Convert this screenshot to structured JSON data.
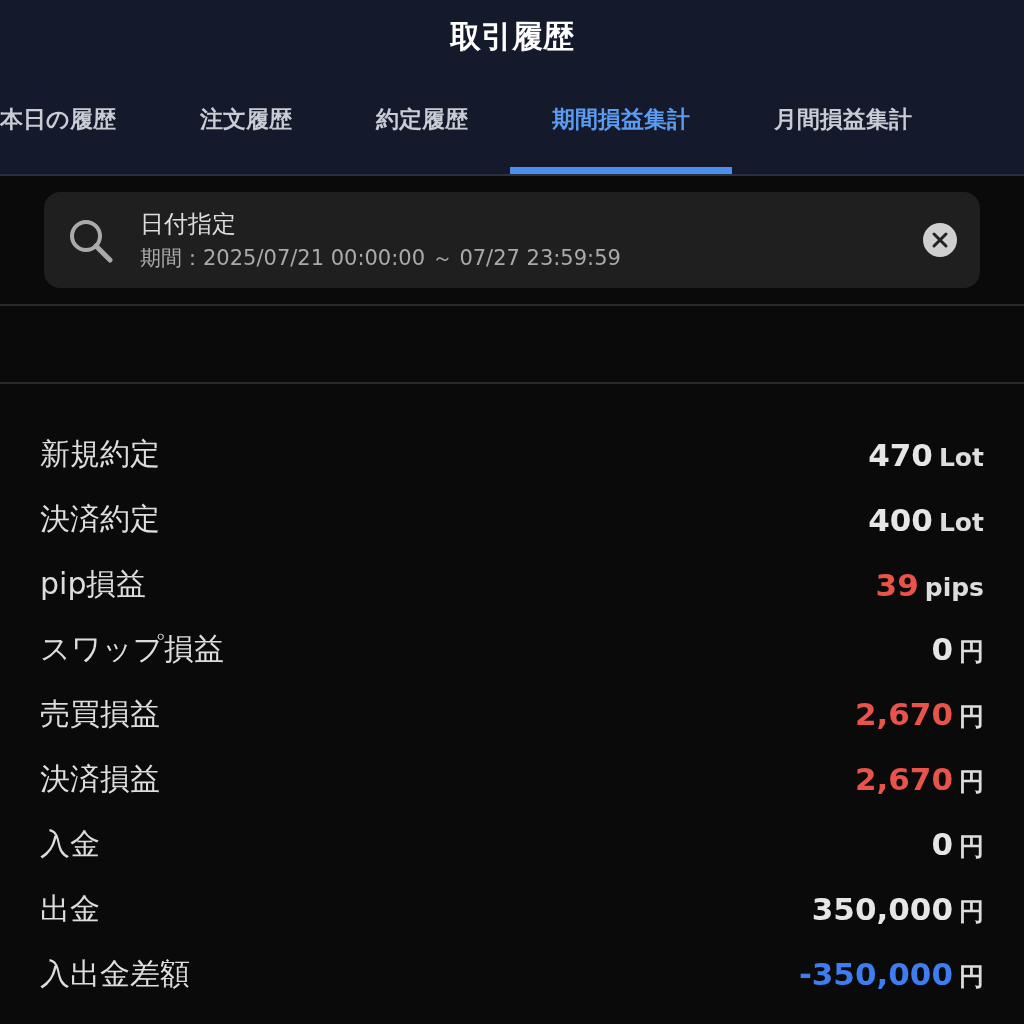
{
  "header": {
    "title": "取引履歴"
  },
  "tabs": [
    {
      "label": "本日の履歴",
      "selected": false
    },
    {
      "label": "注文履歴",
      "selected": false
    },
    {
      "label": "約定履歴",
      "selected": false
    },
    {
      "label": "期間損益集計",
      "selected": true
    },
    {
      "label": "月間損益集計",
      "selected": false
    }
  ],
  "search": {
    "label": "日付指定",
    "period": "期間：2025/07/21 00:00:00 ～ 07/27 23:59:59"
  },
  "rows": [
    {
      "label": "新規約定",
      "value": "470",
      "unit": "Lot",
      "color": "#e6e6e6"
    },
    {
      "label": "決済約定",
      "value": "400",
      "unit": "Lot",
      "color": "#e6e6e6"
    },
    {
      "label": "pip損益",
      "value": "39",
      "unit": "pips",
      "color": "#e8534a"
    },
    {
      "label": "スワップ損益",
      "value": "0",
      "unit": "円",
      "color": "#e6e6e6"
    },
    {
      "label": "売買損益",
      "value": "2,670",
      "unit": "円",
      "color": "#e8534a"
    },
    {
      "label": "決済損益",
      "value": "2,670",
      "unit": "円",
      "color": "#e8534a"
    },
    {
      "label": "入金",
      "value": "0",
      "unit": "円",
      "color": "#e6e6e6"
    },
    {
      "label": "出金",
      "value": "350,000",
      "unit": "円",
      "color": "#e6e6e6"
    },
    {
      "label": "入出金差額",
      "value": "-350,000",
      "unit": "円",
      "color": "#3d7df0"
    }
  ]
}
